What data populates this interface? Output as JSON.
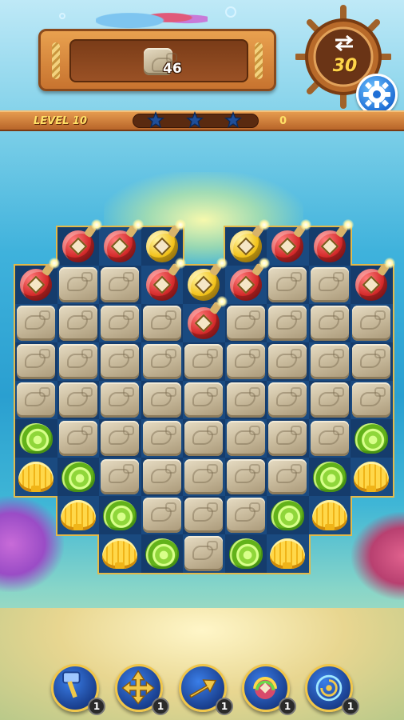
{
  "hud": {
    "goal": {
      "item": "stone-block",
      "remaining": "46"
    },
    "moves": {
      "value": "30",
      "icon": "swap-arrows-icon"
    },
    "level": {
      "label": "LEVEL 10"
    },
    "progress": {
      "stars_total": 3,
      "stars_earned": 0,
      "fill": 0.0
    },
    "score": {
      "value": "0"
    },
    "settings": {
      "icon": "gear-icon"
    }
  },
  "board": {
    "columns": 9,
    "rows": 9,
    "grid": [
      [
        "void",
        "bomb-red",
        "bomb-red",
        "bomb-gold",
        "void",
        "bomb-gold",
        "bomb-red",
        "bomb-red",
        "void"
      ],
      [
        "bomb-red",
        "stone",
        "stone",
        "bomb-red",
        "bomb-gold",
        "bomb-red",
        "stone",
        "stone",
        "bomb-red"
      ],
      [
        "stone",
        "stone",
        "stone",
        "stone",
        "bomb-red",
        "stone",
        "stone",
        "stone",
        "stone"
      ],
      [
        "stone",
        "stone",
        "stone",
        "stone",
        "stone",
        "stone",
        "stone",
        "stone",
        "stone"
      ],
      [
        "stone",
        "stone",
        "stone",
        "stone",
        "stone",
        "stone",
        "stone",
        "stone",
        "stone"
      ],
      [
        "shell-green",
        "stone",
        "stone",
        "stone",
        "stone",
        "stone",
        "stone",
        "stone",
        "shell-green"
      ],
      [
        "shell-yellow",
        "shell-green",
        "stone",
        "stone",
        "stone",
        "stone",
        "stone",
        "shell-green",
        "shell-yellow"
      ],
      [
        "void",
        "shell-yellow",
        "shell-green",
        "stone",
        "stone",
        "stone",
        "shell-green",
        "shell-yellow",
        "void"
      ],
      [
        "void",
        "void",
        "shell-yellow",
        "shell-green",
        "stone",
        "shell-green",
        "shell-yellow",
        "void",
        "void"
      ]
    ]
  },
  "boosters": [
    {
      "name": "hammer",
      "icon": "hammer-icon",
      "count": "1"
    },
    {
      "name": "cross-arrow",
      "icon": "cross-arrow-icon",
      "count": "1"
    },
    {
      "name": "arrow",
      "icon": "arrow-icon",
      "count": "1"
    },
    {
      "name": "rainbow-bomb",
      "icon": "rainbow-bomb-icon",
      "count": "1"
    },
    {
      "name": "whirlpool",
      "icon": "whirlpool-icon",
      "count": "1"
    }
  ],
  "colors": {
    "wood": "#c7732f",
    "board_bg": "#173f72",
    "board_border": "#e2b94a",
    "level_text": "#ffe066",
    "moves_text": "#ffd54a",
    "booster_ring": "#f0c64a"
  }
}
